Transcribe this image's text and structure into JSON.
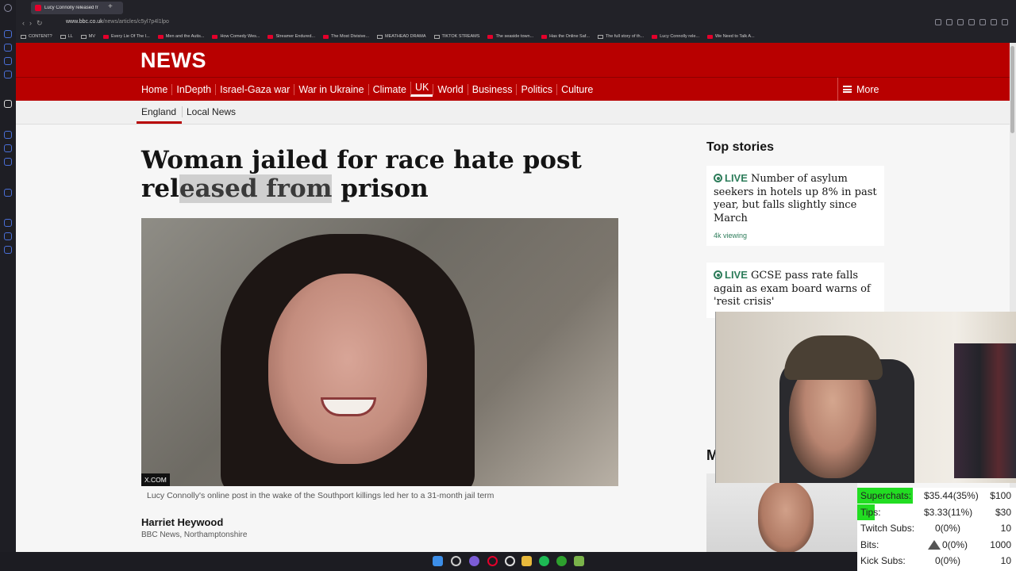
{
  "browser": {
    "tab_title": "Lucy Connolly released fr",
    "new_tab": "+",
    "url_domain": "www.bbc.co.uk",
    "url_path": "/news/articles/c5yl7p4l1lpo",
    "bookmarks": [
      {
        "label": "CONTENT?",
        "icon": "folder"
      },
      {
        "label": "LL",
        "icon": "leaf"
      },
      {
        "label": "MV",
        "icon": "twitch"
      },
      {
        "label": "Every Lie Of The I...",
        "icon": "youtube"
      },
      {
        "label": "Men and the Autis...",
        "icon": "youtube"
      },
      {
        "label": "How Comedy Wes...",
        "icon": "youtube"
      },
      {
        "label": "Streamer Endured...",
        "icon": "youtube"
      },
      {
        "label": "The Most Divisive...",
        "icon": "youtube"
      },
      {
        "label": "MEATHEAD DRAMA",
        "icon": "folder"
      },
      {
        "label": "TIKTOK STREAMS",
        "icon": "folder"
      },
      {
        "label": "The seaside town...",
        "icon": "youtube"
      },
      {
        "label": "Has the Online Saf...",
        "icon": "youtube"
      },
      {
        "label": "The full story of th...",
        "icon": "page"
      },
      {
        "label": "Lucy Connolly rele...",
        "icon": "bbc"
      },
      {
        "label": "We Need to Talk A...",
        "icon": "youtube"
      }
    ]
  },
  "bbc": {
    "logo": "NEWS",
    "nav": [
      "Home",
      "InDepth",
      "Israel-Gaza war",
      "War in Ukraine",
      "Climate",
      "UK",
      "World",
      "Business",
      "Politics",
      "Culture"
    ],
    "more": "More",
    "subnav": [
      "England",
      "Local News"
    ]
  },
  "article": {
    "headline_part1": "Woman jailed for race hate post rel",
    "headline_highlight": "eased from",
    "headline_part2": " prison",
    "image_credit": "X.COM",
    "caption": "Lucy Connolly's online post in the wake of the Southport killings led her to a 31-month jail term",
    "author": "Harriet Heywood",
    "author_source": "BBC News, Northamptonshire"
  },
  "top_stories": {
    "title": "Top stories",
    "stories": [
      {
        "live": "LIVE",
        "text": "Number of asylum seekers in hotels up 8% in past year, but falls slightly since March",
        "meta": "4k viewing"
      },
      {
        "live": "LIVE",
        "text": "GCSE pass rate falls again as exam board warns of 'resit crisis'",
        "meta": ""
      }
    ],
    "partial_heading": "M"
  },
  "stream_overlay": {
    "rows": [
      {
        "label": "Superchats:",
        "value": "$35.44(35%)",
        "goal": "$100",
        "progress": 0.35
      },
      {
        "label": "Tips:",
        "value": "$3.33(11%)",
        "goal": "$30",
        "progress": 0.11
      },
      {
        "label": "Twitch Subs:",
        "value": "0(0%)",
        "goal": "10",
        "progress": 0
      },
      {
        "label": "Bits:",
        "value": "0(0%)",
        "goal": "1000",
        "progress": 0
      },
      {
        "label": "Kick Subs:",
        "value": "0(0%)",
        "goal": "10",
        "progress": 0
      }
    ]
  },
  "colors": {
    "bbc_red": "#b80000",
    "live_green": "#2e7d5b",
    "overlay_green": "#22dd22"
  }
}
